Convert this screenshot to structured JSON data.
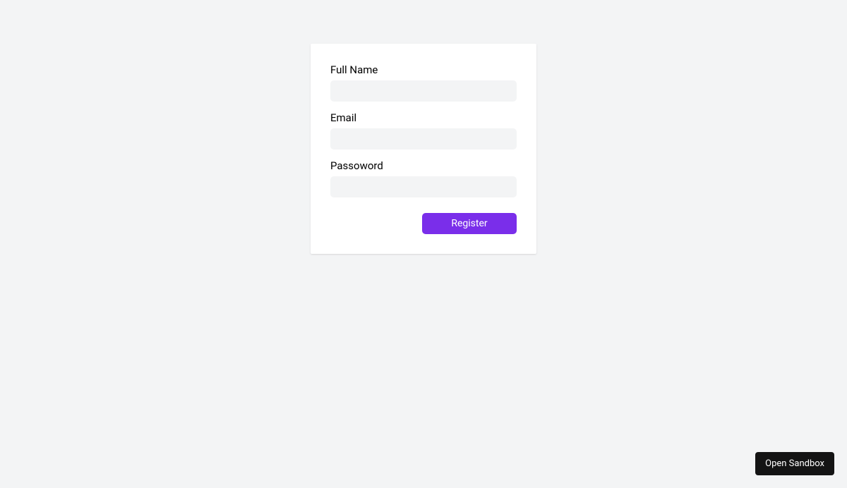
{
  "form": {
    "fields": {
      "fullname": {
        "label": "Full Name",
        "value": ""
      },
      "email": {
        "label": "Email",
        "value": ""
      },
      "password": {
        "label": "Passoword",
        "value": ""
      }
    },
    "submit_label": "Register"
  },
  "sandbox": {
    "button_label": "Open Sandbox"
  }
}
